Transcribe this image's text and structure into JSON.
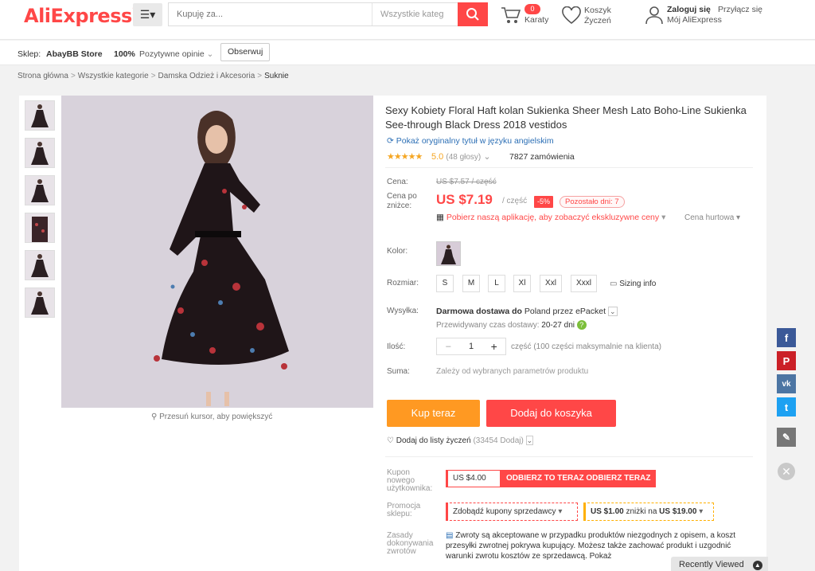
{
  "header": {
    "logo": "AliExpress",
    "logo_mark": "®",
    "search_placeholder": "Kupuję za...",
    "search_category": "Wszystkie kateg",
    "cart_count": "0",
    "cart_label": "Karaty",
    "wishlist_line1": "Koszyk",
    "wishlist_line2": "Życzeń",
    "login": "Zaloguj się",
    "join": "Przyłącz się",
    "my_account": "Mój AliExpress"
  },
  "store": {
    "label": "Sklep:",
    "name": "AbayBB Store",
    "rating": "100%",
    "rating_label": "Pozytywne opinie",
    "follow": "Obserwuj"
  },
  "breadcrumb": {
    "items": [
      "Strona główna",
      "Wszystkie kategorie",
      "Damska Odzież i Akcesoria"
    ],
    "current": "Suknie",
    "sep": ">"
  },
  "gallery": {
    "zoom_hint": "Przesuń kursor, aby powiększyć"
  },
  "product": {
    "title": "Sexy Kobiety Floral Haft kolan Sukienka Sheer Mesh Lato Boho-Line Sukienka See-through Black Dress 2018 vestidos",
    "translate": "Pokaż oryginalny tytuł w języku angielskim",
    "stars": "★★★★★",
    "rating": "5.0",
    "votes": "(48 głosy)",
    "orders": "7827 zamówienia",
    "price_label": "Cena:",
    "old_price": "US $7.57",
    "old_price_unit": " / część",
    "sale_label_1": "Cena po",
    "sale_label_2": "zniżce:",
    "price": "US $7.19",
    "per_unit": "/ część",
    "discount": "-5%",
    "days_left": "Pozostało dni: 7",
    "app_promo": "Pobierz naszą aplikację, aby zobaczyć ekskluzywne ceny",
    "wholesale": "Cena hurtowa",
    "color_label": "Kolor:",
    "size_label": "Rozmiar:",
    "sizes": [
      "S",
      "M",
      "L",
      "Xl",
      "Xxl",
      "Xxxl"
    ],
    "sizing_info": "Sizing info",
    "shipping_label": "Wysyłka:",
    "shipping_bold": "Darmowa dostawa do",
    "shipping_rest": "Poland przez ePacket",
    "delivery_label": "Przewidywany czas dostawy:",
    "delivery_time": "20-27 dni",
    "qty_label": "Ilość:",
    "qty": "1",
    "qty_note": "część (100 części maksymalnie na klienta)",
    "sum_label": "Suma:",
    "sum_note": "Zależy od wybranych parametrów produktu",
    "buy_now": "Kup teraz",
    "add_to_cart": "Dodaj do koszyka",
    "wishlist": "Dodaj do listy życzeń",
    "wishlist_count": "(33454 Dodaj)",
    "coupon_label_1": "Kupon",
    "coupon_label_2": "nowego",
    "coupon_label_3": "użytkownika:",
    "coupon_value": "US $4.00",
    "coupon_get": "ODBIERZ TO TERAZ ODBIERZ TERAZ",
    "promo_label_1": "Promocja",
    "promo_label_2": "sklepu:",
    "promo_select": "Zdobądź kupony sprzedawcy",
    "promo_value": "US $1.00",
    "promo_mid": " zniżki na ",
    "promo_min": "US $19.00",
    "returns_label_1": "Zasady",
    "returns_label_2": "dokonywania",
    "returns_label_3": "zwrotów",
    "returns_text": "Zwroty są akceptowane w przypadku produktów niezgodnych z opisem, a koszt przesyłki zwrotnej pokrywa kupujący. Możesz także zachować produkt i uzgodnić warunki zwrotu kosztów ze sprzedawcą. Pokaż"
  },
  "social": {
    "facebook": "f",
    "pinterest": "P",
    "vk": "vk",
    "twitter": "t"
  },
  "recent": {
    "label": "Recently Viewed"
  },
  "colors": {
    "brand": "#ff4747",
    "orange": "#ff9922",
    "link": "#2c6fb5",
    "star": "#f5a623"
  }
}
